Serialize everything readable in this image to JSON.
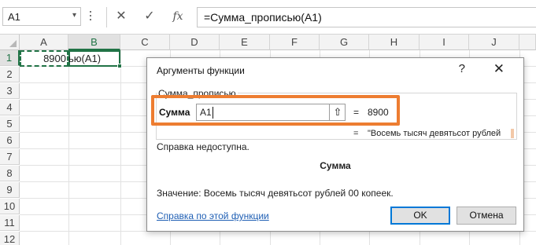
{
  "formula_bar": {
    "name_box": "A1",
    "name_box_arrow": "▾",
    "cancel_glyph": "✕",
    "enter_glyph": "✓",
    "fx_glyph": "fx",
    "formula": "=Сумма_прописью(A1)"
  },
  "sheet": {
    "columns": [
      "A",
      "B",
      "C",
      "D",
      "E",
      "F",
      "G",
      "H",
      "I",
      "J"
    ],
    "rows": [
      "1",
      "2",
      "3",
      "4",
      "5",
      "6",
      "7",
      "8",
      "9",
      "10",
      "11",
      "12"
    ],
    "cell_a1": "8900",
    "cell_b1_overflow": "ью(A1)"
  },
  "dialog": {
    "title": "Аргументы функции",
    "help_glyph": "?",
    "close_glyph": "✕",
    "function_group_label": "Сумма_прописью",
    "argument_label": "Сумма",
    "argument_value": "A1",
    "collapse_glyph": "⇧",
    "equals": "=",
    "argument_result": "8900",
    "result_equals": "=",
    "result_preview": "\"Восемь тысяч девятьсот рублей",
    "help_unavailable": "Справка недоступна.",
    "function_arg_name": "Сумма",
    "value_line": "Значение:   Восемь тысяч девятьсот рублей  00 копеек.",
    "help_link": "Справка по этой функции",
    "ok_label": "OK",
    "cancel_label": "Отмена"
  },
  "colors": {
    "excel_green": "#217346",
    "highlight_orange": "#ed7d31",
    "link_blue": "#1f5fb4",
    "ok_border": "#0078d7"
  }
}
